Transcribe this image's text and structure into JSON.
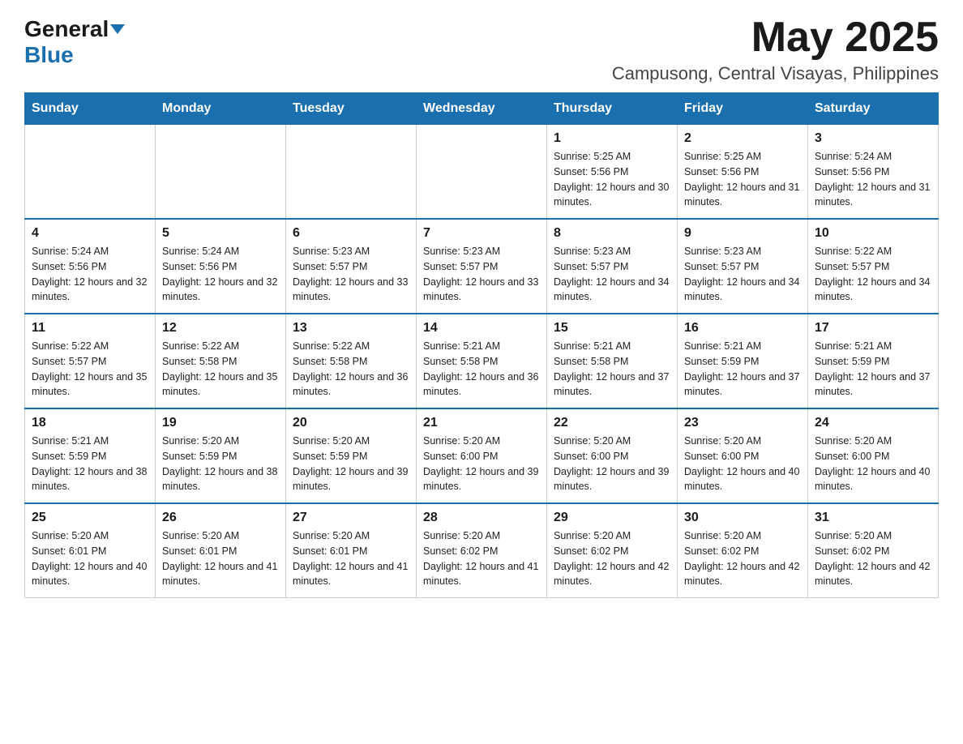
{
  "header": {
    "logo_general": "General",
    "logo_blue": "Blue",
    "month_year": "May 2025",
    "location": "Campusong, Central Visayas, Philippines"
  },
  "weekdays": [
    "Sunday",
    "Monday",
    "Tuesday",
    "Wednesday",
    "Thursday",
    "Friday",
    "Saturday"
  ],
  "weeks": [
    {
      "days": [
        {
          "number": "",
          "sunrise": "",
          "sunset": "",
          "daylight": "",
          "empty": true
        },
        {
          "number": "",
          "sunrise": "",
          "sunset": "",
          "daylight": "",
          "empty": true
        },
        {
          "number": "",
          "sunrise": "",
          "sunset": "",
          "daylight": "",
          "empty": true
        },
        {
          "number": "",
          "sunrise": "",
          "sunset": "",
          "daylight": "",
          "empty": true
        },
        {
          "number": "1",
          "sunrise": "Sunrise: 5:25 AM",
          "sunset": "Sunset: 5:56 PM",
          "daylight": "Daylight: 12 hours and 30 minutes.",
          "empty": false
        },
        {
          "number": "2",
          "sunrise": "Sunrise: 5:25 AM",
          "sunset": "Sunset: 5:56 PM",
          "daylight": "Daylight: 12 hours and 31 minutes.",
          "empty": false
        },
        {
          "number": "3",
          "sunrise": "Sunrise: 5:24 AM",
          "sunset": "Sunset: 5:56 PM",
          "daylight": "Daylight: 12 hours and 31 minutes.",
          "empty": false
        }
      ]
    },
    {
      "days": [
        {
          "number": "4",
          "sunrise": "Sunrise: 5:24 AM",
          "sunset": "Sunset: 5:56 PM",
          "daylight": "Daylight: 12 hours and 32 minutes.",
          "empty": false
        },
        {
          "number": "5",
          "sunrise": "Sunrise: 5:24 AM",
          "sunset": "Sunset: 5:56 PM",
          "daylight": "Daylight: 12 hours and 32 minutes.",
          "empty": false
        },
        {
          "number": "6",
          "sunrise": "Sunrise: 5:23 AM",
          "sunset": "Sunset: 5:57 PM",
          "daylight": "Daylight: 12 hours and 33 minutes.",
          "empty": false
        },
        {
          "number": "7",
          "sunrise": "Sunrise: 5:23 AM",
          "sunset": "Sunset: 5:57 PM",
          "daylight": "Daylight: 12 hours and 33 minutes.",
          "empty": false
        },
        {
          "number": "8",
          "sunrise": "Sunrise: 5:23 AM",
          "sunset": "Sunset: 5:57 PM",
          "daylight": "Daylight: 12 hours and 34 minutes.",
          "empty": false
        },
        {
          "number": "9",
          "sunrise": "Sunrise: 5:23 AM",
          "sunset": "Sunset: 5:57 PM",
          "daylight": "Daylight: 12 hours and 34 minutes.",
          "empty": false
        },
        {
          "number": "10",
          "sunrise": "Sunrise: 5:22 AM",
          "sunset": "Sunset: 5:57 PM",
          "daylight": "Daylight: 12 hours and 34 minutes.",
          "empty": false
        }
      ]
    },
    {
      "days": [
        {
          "number": "11",
          "sunrise": "Sunrise: 5:22 AM",
          "sunset": "Sunset: 5:57 PM",
          "daylight": "Daylight: 12 hours and 35 minutes.",
          "empty": false
        },
        {
          "number": "12",
          "sunrise": "Sunrise: 5:22 AM",
          "sunset": "Sunset: 5:58 PM",
          "daylight": "Daylight: 12 hours and 35 minutes.",
          "empty": false
        },
        {
          "number": "13",
          "sunrise": "Sunrise: 5:22 AM",
          "sunset": "Sunset: 5:58 PM",
          "daylight": "Daylight: 12 hours and 36 minutes.",
          "empty": false
        },
        {
          "number": "14",
          "sunrise": "Sunrise: 5:21 AM",
          "sunset": "Sunset: 5:58 PM",
          "daylight": "Daylight: 12 hours and 36 minutes.",
          "empty": false
        },
        {
          "number": "15",
          "sunrise": "Sunrise: 5:21 AM",
          "sunset": "Sunset: 5:58 PM",
          "daylight": "Daylight: 12 hours and 37 minutes.",
          "empty": false
        },
        {
          "number": "16",
          "sunrise": "Sunrise: 5:21 AM",
          "sunset": "Sunset: 5:59 PM",
          "daylight": "Daylight: 12 hours and 37 minutes.",
          "empty": false
        },
        {
          "number": "17",
          "sunrise": "Sunrise: 5:21 AM",
          "sunset": "Sunset: 5:59 PM",
          "daylight": "Daylight: 12 hours and 37 minutes.",
          "empty": false
        }
      ]
    },
    {
      "days": [
        {
          "number": "18",
          "sunrise": "Sunrise: 5:21 AM",
          "sunset": "Sunset: 5:59 PM",
          "daylight": "Daylight: 12 hours and 38 minutes.",
          "empty": false
        },
        {
          "number": "19",
          "sunrise": "Sunrise: 5:20 AM",
          "sunset": "Sunset: 5:59 PM",
          "daylight": "Daylight: 12 hours and 38 minutes.",
          "empty": false
        },
        {
          "number": "20",
          "sunrise": "Sunrise: 5:20 AM",
          "sunset": "Sunset: 5:59 PM",
          "daylight": "Daylight: 12 hours and 39 minutes.",
          "empty": false
        },
        {
          "number": "21",
          "sunrise": "Sunrise: 5:20 AM",
          "sunset": "Sunset: 6:00 PM",
          "daylight": "Daylight: 12 hours and 39 minutes.",
          "empty": false
        },
        {
          "number": "22",
          "sunrise": "Sunrise: 5:20 AM",
          "sunset": "Sunset: 6:00 PM",
          "daylight": "Daylight: 12 hours and 39 minutes.",
          "empty": false
        },
        {
          "number": "23",
          "sunrise": "Sunrise: 5:20 AM",
          "sunset": "Sunset: 6:00 PM",
          "daylight": "Daylight: 12 hours and 40 minutes.",
          "empty": false
        },
        {
          "number": "24",
          "sunrise": "Sunrise: 5:20 AM",
          "sunset": "Sunset: 6:00 PM",
          "daylight": "Daylight: 12 hours and 40 minutes.",
          "empty": false
        }
      ]
    },
    {
      "days": [
        {
          "number": "25",
          "sunrise": "Sunrise: 5:20 AM",
          "sunset": "Sunset: 6:01 PM",
          "daylight": "Daylight: 12 hours and 40 minutes.",
          "empty": false
        },
        {
          "number": "26",
          "sunrise": "Sunrise: 5:20 AM",
          "sunset": "Sunset: 6:01 PM",
          "daylight": "Daylight: 12 hours and 41 minutes.",
          "empty": false
        },
        {
          "number": "27",
          "sunrise": "Sunrise: 5:20 AM",
          "sunset": "Sunset: 6:01 PM",
          "daylight": "Daylight: 12 hours and 41 minutes.",
          "empty": false
        },
        {
          "number": "28",
          "sunrise": "Sunrise: 5:20 AM",
          "sunset": "Sunset: 6:02 PM",
          "daylight": "Daylight: 12 hours and 41 minutes.",
          "empty": false
        },
        {
          "number": "29",
          "sunrise": "Sunrise: 5:20 AM",
          "sunset": "Sunset: 6:02 PM",
          "daylight": "Daylight: 12 hours and 42 minutes.",
          "empty": false
        },
        {
          "number": "30",
          "sunrise": "Sunrise: 5:20 AM",
          "sunset": "Sunset: 6:02 PM",
          "daylight": "Daylight: 12 hours and 42 minutes.",
          "empty": false
        },
        {
          "number": "31",
          "sunrise": "Sunrise: 5:20 AM",
          "sunset": "Sunset: 6:02 PM",
          "daylight": "Daylight: 12 hours and 42 minutes.",
          "empty": false
        }
      ]
    }
  ]
}
